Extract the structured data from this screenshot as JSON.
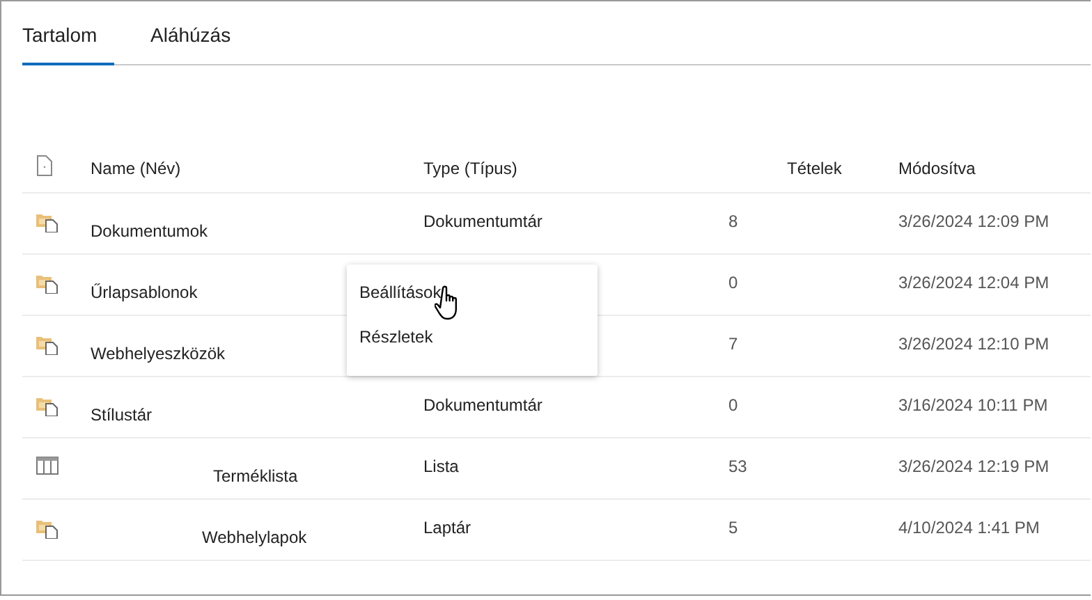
{
  "tabs": [
    {
      "label": "Tartalom",
      "selected": true
    },
    {
      "label": "Aláhúzás",
      "selected": false
    }
  ],
  "table": {
    "columns": [
      "Name (Név)",
      "Type (Típus)",
      "Tételek",
      "Módosítva"
    ],
    "rows": [
      {
        "kind": "library",
        "name": "Dokumentumok",
        "type": "Dokumentumtár",
        "items": "8",
        "modified": "3/26/2024 12:09 PM"
      },
      {
        "kind": "library",
        "name": "Űrlapsablonok",
        "items": "0",
        "modified": "3/26/2024 12:04 PM"
      },
      {
        "kind": "library",
        "name": "Webhelyeszközök",
        "items": "7",
        "modified": "3/26/2024 12:10 PM"
      },
      {
        "kind": "library",
        "name": "Stílustár",
        "type": "Dokumentumtár",
        "items": "0",
        "modified": "3/16/2024 10:11 PM"
      },
      {
        "kind": "list",
        "name": "Terméklista",
        "type": "Lista",
        "items": "53",
        "modified": "3/26/2024 12:19 PM"
      },
      {
        "kind": "library",
        "name": "Webhelylapok",
        "type": "Laptár",
        "items": "5",
        "modified": "4/10/2024 1:41 PM"
      }
    ]
  },
  "context_menu": {
    "items": [
      "Beállítások",
      "Részletek"
    ]
  }
}
